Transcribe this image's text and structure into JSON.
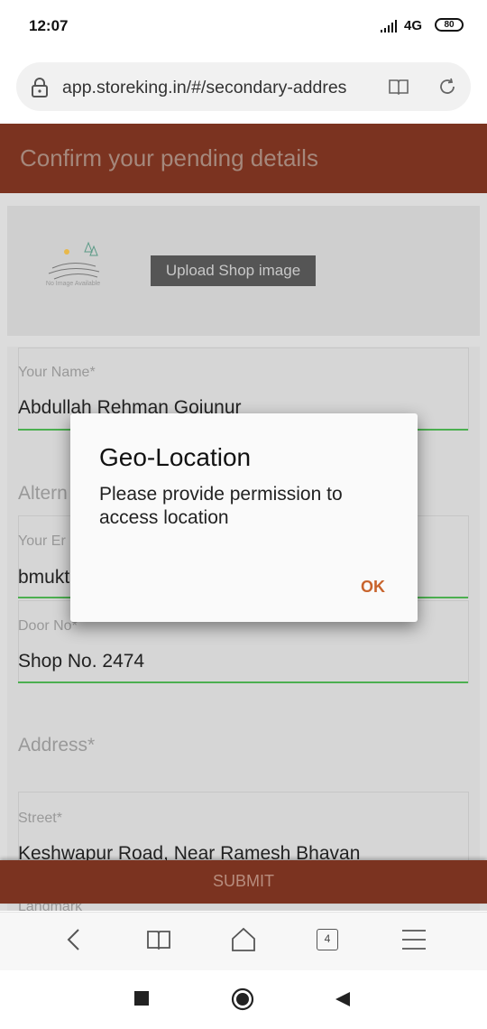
{
  "status_bar": {
    "time": "12:07",
    "network": "4G",
    "battery": "80"
  },
  "browser": {
    "url": "app.storeking.in/#/secondary-addres",
    "tab_count": "4"
  },
  "page": {
    "title": "Confirm your pending details",
    "no_image_text": "No Image Available",
    "upload_button": "Upload Shop image",
    "fields": {
      "name": {
        "label": "Your Name*",
        "value": "Abdullah Rehman Gojunur"
      },
      "alternate": {
        "label": "Altern"
      },
      "email": {
        "label": "Your Er",
        "value": "bmukt"
      },
      "door": {
        "label": "Door No*",
        "value": "Shop No. 2474"
      },
      "address": {
        "label": "Address*"
      },
      "street": {
        "label": "Street*",
        "value": "Keshwapur Road, Near Ramesh Bhavan"
      },
      "landmark": {
        "label": "Landmark"
      }
    },
    "submit_button": "SUBMIT"
  },
  "dialog": {
    "title": "Geo-Location",
    "message": "Please provide permission to access location",
    "ok_button": "OK"
  }
}
